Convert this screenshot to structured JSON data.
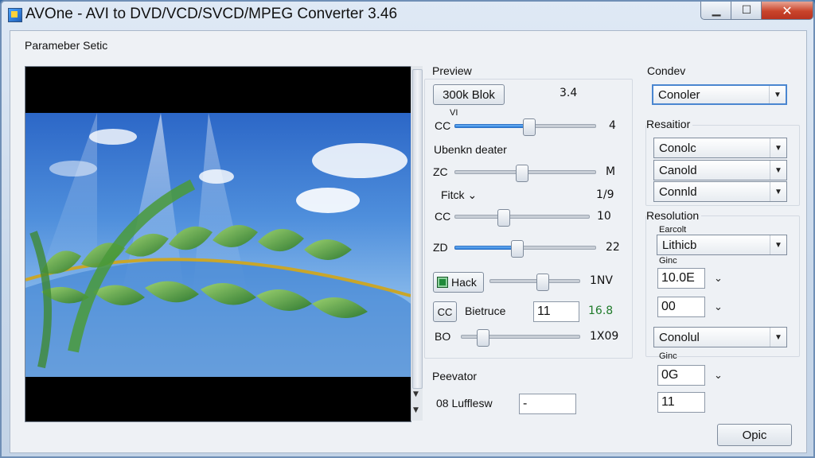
{
  "window": {
    "title": "AVOne - AVI to DVD/VCD/SVCD/MPEG Converter 3.46",
    "minimize": "▁",
    "maximize": "☐",
    "close": "✕"
  },
  "param_group": {
    "title": "Parameber Setic"
  },
  "middle": {
    "preview_title": "Preview",
    "bitrate_button": "300k Blok",
    "bitrate_value": "3.4",
    "vi_label": "VI",
    "row1": {
      "label": "CC",
      "value": "4",
      "level": 0.52
    },
    "blend_label": "Ubenkn deater",
    "row2": {
      "label": "ZC",
      "value": "M",
      "level": 0.47
    },
    "flick_label": "Fitck ⌄",
    "flick_value": "1/9",
    "row3": {
      "label": "CC",
      "value": "10",
      "level": 0.36
    },
    "row4": {
      "label": "ZD",
      "value": "22",
      "level": 0.44
    },
    "hack_label": "Hack",
    "hack_value": "1NV",
    "hack_level": 0.58,
    "cc_button": "CC",
    "structure_label": "Bietruce",
    "structure_input": "11",
    "structure_value": "16.8",
    "bo_label": "BO",
    "bo_value": "1X09",
    "bo_level": 0.18,
    "separator_title": "Peevator",
    "filter_label": "08 Lufflesw",
    "filter_input": "-"
  },
  "right": {
    "conveter_title": "Condev",
    "conveter_combo": "Conoler",
    "resolution1_title": "Resaitior",
    "combo_a": "Conolc",
    "combo_b": "Canold",
    "combo_c": "Connld",
    "resolution2_title": "Resolution",
    "format_label": "Earcolt",
    "format_combo": "Lithicb",
    "gain_label": "Ginc",
    "gain_input1": "10.0E",
    "gain_input2": "00",
    "combo_d": "Conolul",
    "gain2_label": "Ginc",
    "gain_input3": "0G",
    "gain_input4": "11",
    "option_button": "Opic"
  }
}
